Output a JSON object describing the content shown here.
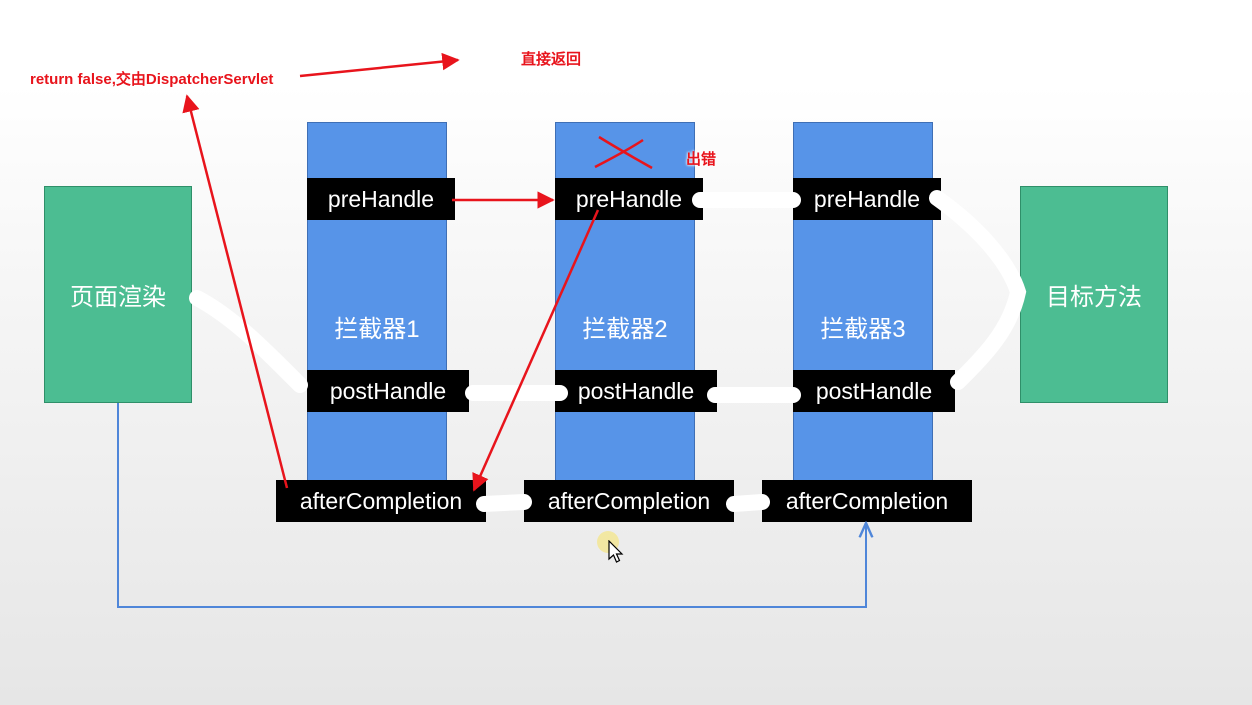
{
  "diagram": {
    "render_box": "页面渲染",
    "target_box": "目标方法",
    "interceptors": [
      {
        "name": "拦截器1",
        "pre": "preHandle",
        "post": "postHandle",
        "after": "afterCompletion"
      },
      {
        "name": "拦截器2",
        "pre": "preHandle",
        "post": "postHandle",
        "after": "afterCompletion"
      },
      {
        "name": "拦截器3",
        "pre": "preHandle",
        "post": "postHandle",
        "after": "afterCompletion"
      }
    ],
    "annotations": {
      "return_false": "return false,交由DispatcherServlet",
      "direct_return": "直接返回",
      "error": "出错"
    },
    "colors": {
      "box_green": "#4cbd92",
      "box_blue": "#5794e8",
      "annotation_red": "#e8141c",
      "connector_blue": "#4f86d9"
    }
  }
}
